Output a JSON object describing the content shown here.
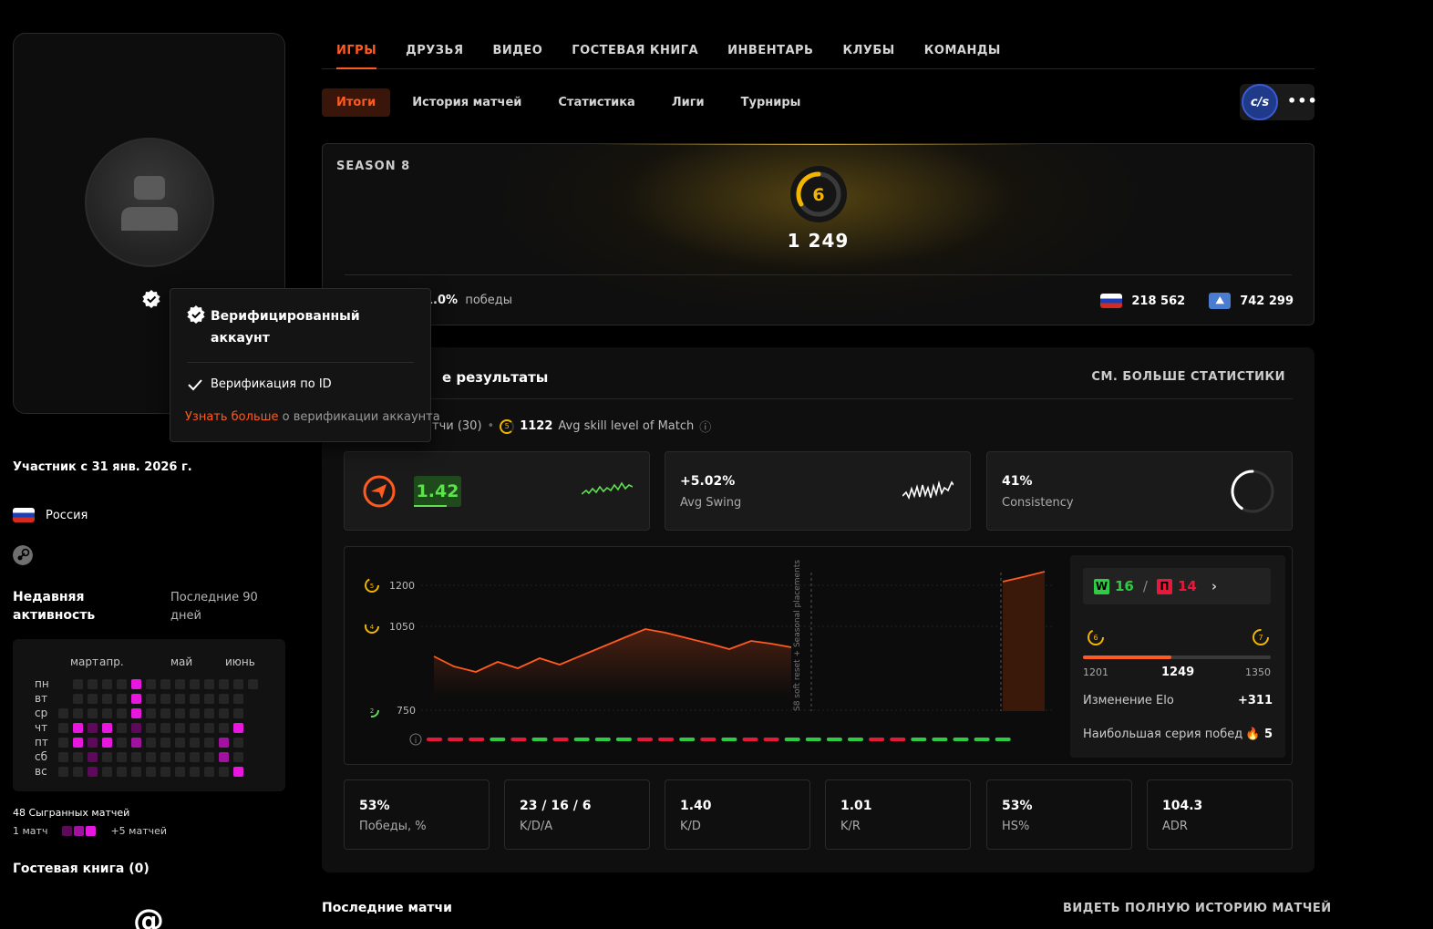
{
  "nav": {
    "tabs": [
      "ИГРЫ",
      "ДРУЗЬЯ",
      "ВИДЕО",
      "ГОСТЕВАЯ КНИГА",
      "ИНВЕНТАРЬ",
      "КЛУБЫ",
      "КОМАНДЫ"
    ],
    "active": 0
  },
  "subnav": {
    "tabs": [
      "Итоги",
      "История матчей",
      "Статистика",
      "Лиги",
      "Турниры"
    ],
    "active": 0
  },
  "game": {
    "logo_text": "c/s",
    "more": "•••"
  },
  "tooltip": {
    "title": "Верифицированный аккаунт",
    "row": "Верификация по ID",
    "more_link": "Узнать больше",
    "more_text": " о верификации аккаунта"
  },
  "profile": {
    "member_since": "Участник с 31 янв. 2026 г.",
    "country": "Россия"
  },
  "activity": {
    "title": "Недавняя активность",
    "subtitle": "Последние 90 дней",
    "months": [
      "март",
      "апр.",
      "май",
      "июнь"
    ],
    "days": [
      "пн",
      "вт",
      "ср",
      "чт",
      "пт",
      "сб",
      "вс"
    ],
    "played": "48 Сыгранных матчей",
    "legend_left": "1 матч",
    "legend_right": "+5 матчей"
  },
  "guestbook": {
    "title": "Гостевая книга (0)",
    "icon": "@"
  },
  "season": {
    "label": "SEASON 8",
    "level": "6",
    "elo": "1 249",
    "win_rate": "1.0%",
    "win_label": "победы",
    "country_rank": "218 562",
    "region_rank": "742 299"
  },
  "results": {
    "title": "е результаты",
    "more": "СМ. БОЛЬШЕ СТАТИСТИКИ",
    "info_matches": "тчи (30)",
    "info_dot": "•",
    "info_skill": "1122",
    "info_skill_label": "Avg skill level of Match",
    "info_icon": "ⓘ",
    "cards": [
      {
        "value": "1.42",
        "label": ""
      },
      {
        "value": "+5.02%",
        "label": "Avg Swing"
      },
      {
        "value": "41%",
        "label": "Consistency"
      }
    ],
    "chart": {
      "levels": [
        {
          "level": "5",
          "value": "1200"
        },
        {
          "level": "4",
          "value": "1050"
        },
        {
          "level": "2",
          "value": "750"
        }
      ],
      "annotation": "S8 soft reset + Seasonal placements"
    },
    "side": {
      "wins": "16",
      "w": "W",
      "slash": "/",
      "losses": "14",
      "l": "П",
      "chevron": "›",
      "level_from": "6",
      "level_to": "7",
      "range_min": "1201",
      "range_cur": "1249",
      "range_max": "1350",
      "progress": 0.47,
      "elo_change_label": "Изменение Elo",
      "elo_change": "+311",
      "streak_label": "Наибольшая серия побед",
      "streak": "5"
    },
    "stats": [
      {
        "value": "53%",
        "label": "Победы, %"
      },
      {
        "value": "23 / 16 / 6",
        "label": "K/D/A"
      },
      {
        "value": "1.40",
        "label": "K/D"
      },
      {
        "value": "1.01",
        "label": "K/R"
      },
      {
        "value": "53%",
        "label": "HS%"
      },
      {
        "value": "104.3",
        "label": "ADR"
      }
    ]
  },
  "last_matches": {
    "title": "Последние матчи",
    "more": "ВИДЕТЬ ПОЛНУЮ ИСТОРИЮ МАТЧЕЙ"
  },
  "colors": {
    "accent": "#ff5a1f",
    "win": "#2ecc40",
    "loss": "#e8183a",
    "heat": "#e817e0"
  }
}
